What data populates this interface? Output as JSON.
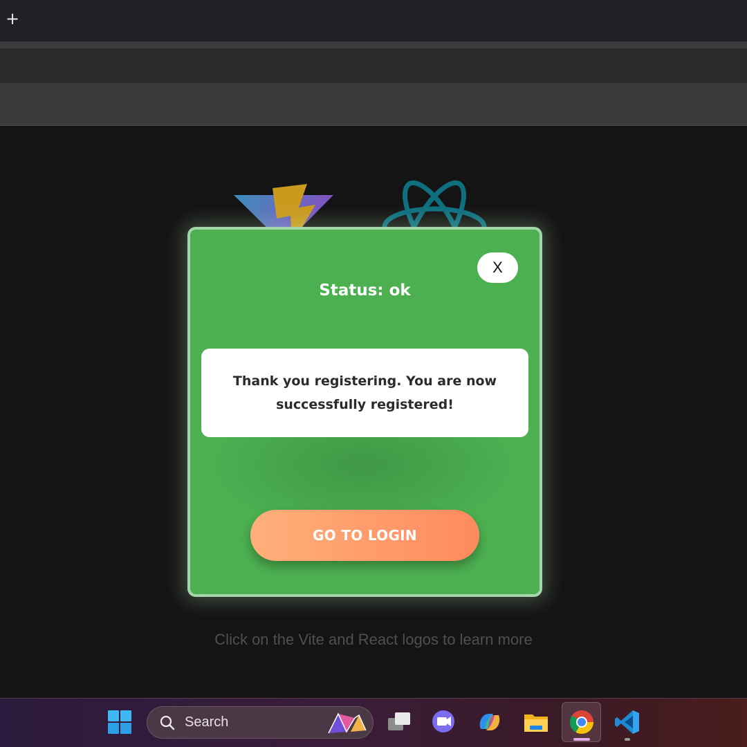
{
  "browser": {
    "new_tab_symbol": "+"
  },
  "app": {
    "hint_text": "Click on the Vite and React logos to learn more",
    "logos": [
      "vite-logo",
      "react-logo"
    ]
  },
  "modal": {
    "close_label": "X",
    "status_text": "Status: ok",
    "message": "Thank you registering. You are now successfully registered!",
    "button_label": "GO TO LOGIN",
    "colors": {
      "background": "#4caf50",
      "border": "#a5d6a7",
      "button_start": "#ffb07a",
      "button_end": "#ff8a5e"
    }
  },
  "taskbar": {
    "search_label": "Search",
    "apps": [
      {
        "name": "start-icon"
      },
      {
        "name": "task-view-icon"
      },
      {
        "name": "teams-meet-icon"
      },
      {
        "name": "copilot-icon"
      },
      {
        "name": "file-explorer-icon"
      },
      {
        "name": "chrome-icon",
        "active": true
      },
      {
        "name": "vscode-icon"
      }
    ]
  }
}
